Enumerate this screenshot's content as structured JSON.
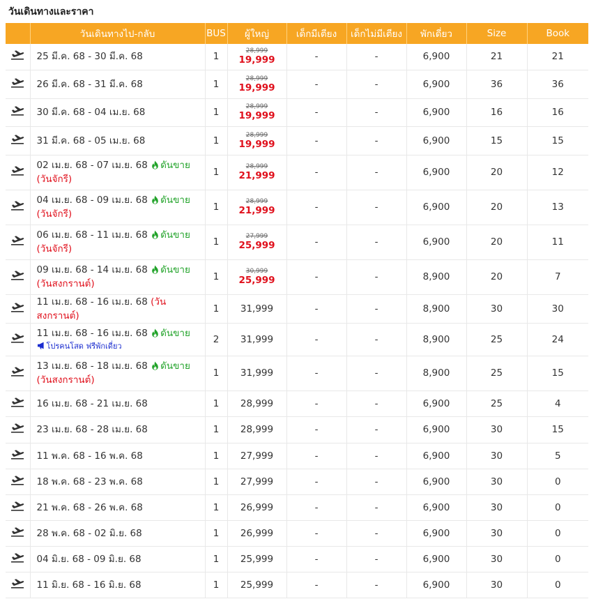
{
  "section_title": "วันเดินทางและราคา",
  "headers": [
    "",
    "วันเดินทางไป-กลับ",
    "BUS",
    "ผู้ใหญ่",
    "เด็กมีเตียง",
    "เด็กไม่มีเตียง",
    "พักเดี่ยว",
    "Size",
    "Book"
  ],
  "colors": {
    "header_bg": "#f7a623",
    "sale_price": "#e0101c",
    "hot_tag": "#22a32a",
    "promo": "#1a2ccf"
  },
  "rows": [
    {
      "dates": "25 มี.ค. 68 - 30 มี.ค. 68",
      "hot": "",
      "holiday": "",
      "promo": "",
      "bus": "1",
      "price_old": "28,999",
      "price": "19,999",
      "child_bed": "-",
      "child_nobed": "-",
      "single": "6,900",
      "size": "21",
      "book": "21"
    },
    {
      "dates": "26 มี.ค. 68 - 31 มี.ค. 68",
      "hot": "",
      "holiday": "",
      "promo": "",
      "bus": "1",
      "price_old": "28,999",
      "price": "19,999",
      "child_bed": "-",
      "child_nobed": "-",
      "single": "6,900",
      "size": "36",
      "book": "36"
    },
    {
      "dates": "30 มี.ค. 68 - 04 เม.ย. 68",
      "hot": "",
      "holiday": "",
      "promo": "",
      "bus": "1",
      "price_old": "28,999",
      "price": "19,999",
      "child_bed": "-",
      "child_nobed": "-",
      "single": "6,900",
      "size": "16",
      "book": "16"
    },
    {
      "dates": "31 มี.ค. 68 - 05 เม.ย. 68",
      "hot": "",
      "holiday": "",
      "promo": "",
      "bus": "1",
      "price_old": "28,999",
      "price": "19,999",
      "child_bed": "-",
      "child_nobed": "-",
      "single": "6,900",
      "size": "15",
      "book": "15"
    },
    {
      "dates": "02 เม.ย. 68 - 07 เม.ย. 68",
      "hot": "ดันขาย",
      "holiday": "(วันจักรี)",
      "promo": "",
      "bus": "1",
      "price_old": "28,999",
      "price": "21,999",
      "child_bed": "-",
      "child_nobed": "-",
      "single": "6,900",
      "size": "20",
      "book": "12"
    },
    {
      "dates": "04 เม.ย. 68 - 09 เม.ย. 68",
      "hot": "ดันขาย",
      "holiday": "(วันจักรี)",
      "promo": "",
      "bus": "1",
      "price_old": "28,999",
      "price": "21,999",
      "child_bed": "-",
      "child_nobed": "-",
      "single": "6,900",
      "size": "20",
      "book": "13"
    },
    {
      "dates": "06 เม.ย. 68 - 11 เม.ย. 68",
      "hot": "ดันขาย",
      "holiday": "(วันจักรี)",
      "promo": "",
      "bus": "1",
      "price_old": "27,999",
      "price": "25,999",
      "child_bed": "-",
      "child_nobed": "-",
      "single": "6,900",
      "size": "20",
      "book": "11"
    },
    {
      "dates": "09 เม.ย. 68 - 14 เม.ย. 68",
      "hot": "ดันขาย",
      "holiday": "(วันสงกรานต์)",
      "promo": "",
      "bus": "1",
      "price_old": "30,999",
      "price": "25,999",
      "child_bed": "-",
      "child_nobed": "-",
      "single": "8,900",
      "size": "20",
      "book": "7"
    },
    {
      "dates": "11 เม.ย. 68 - 16 เม.ย. 68",
      "hot": "",
      "holiday": "(วันสงกรานต์)",
      "promo": "",
      "bus": "1",
      "price_old": "",
      "price": "31,999",
      "child_bed": "-",
      "child_nobed": "-",
      "single": "8,900",
      "size": "30",
      "book": "30"
    },
    {
      "dates": "11 เม.ย. 68 - 16 เม.ย. 68",
      "hot": "ดันขาย",
      "holiday": "",
      "promo": "โปรคนโสด ฟรีพักเดี่ยว",
      "bus": "2",
      "price_old": "",
      "price": "31,999",
      "child_bed": "-",
      "child_nobed": "-",
      "single": "8,900",
      "size": "25",
      "book": "24"
    },
    {
      "dates": "13 เม.ย. 68 - 18 เม.ย. 68",
      "hot": "ดันขาย",
      "holiday": "(วันสงกรานต์)",
      "promo": "",
      "bus": "1",
      "price_old": "",
      "price": "31,999",
      "child_bed": "-",
      "child_nobed": "-",
      "single": "8,900",
      "size": "25",
      "book": "15"
    },
    {
      "dates": "16 เม.ย. 68 - 21 เม.ย. 68",
      "hot": "",
      "holiday": "",
      "promo": "",
      "bus": "1",
      "price_old": "",
      "price": "28,999",
      "child_bed": "-",
      "child_nobed": "-",
      "single": "6,900",
      "size": "25",
      "book": "4"
    },
    {
      "dates": "23 เม.ย. 68 - 28 เม.ย. 68",
      "hot": "",
      "holiday": "",
      "promo": "",
      "bus": "1",
      "price_old": "",
      "price": "28,999",
      "child_bed": "-",
      "child_nobed": "-",
      "single": "6,900",
      "size": "30",
      "book": "15"
    },
    {
      "dates": "11 พ.ค. 68 - 16 พ.ค. 68",
      "hot": "",
      "holiday": "",
      "promo": "",
      "bus": "1",
      "price_old": "",
      "price": "27,999",
      "child_bed": "-",
      "child_nobed": "-",
      "single": "6,900",
      "size": "30",
      "book": "5"
    },
    {
      "dates": "18 พ.ค. 68 - 23 พ.ค. 68",
      "hot": "",
      "holiday": "",
      "promo": "",
      "bus": "1",
      "price_old": "",
      "price": "27,999",
      "child_bed": "-",
      "child_nobed": "-",
      "single": "6,900",
      "size": "30",
      "book": "0"
    },
    {
      "dates": "21 พ.ค. 68 - 26 พ.ค. 68",
      "hot": "",
      "holiday": "",
      "promo": "",
      "bus": "1",
      "price_old": "",
      "price": "26,999",
      "child_bed": "-",
      "child_nobed": "-",
      "single": "6,900",
      "size": "30",
      "book": "0"
    },
    {
      "dates": "28 พ.ค. 68 - 02 มิ.ย. 68",
      "hot": "",
      "holiday": "",
      "promo": "",
      "bus": "1",
      "price_old": "",
      "price": "26,999",
      "child_bed": "-",
      "child_nobed": "-",
      "single": "6,900",
      "size": "30",
      "book": "0"
    },
    {
      "dates": "04 มิ.ย. 68 - 09 มิ.ย. 68",
      "hot": "",
      "holiday": "",
      "promo": "",
      "bus": "1",
      "price_old": "",
      "price": "25,999",
      "child_bed": "-",
      "child_nobed": "-",
      "single": "6,900",
      "size": "30",
      "book": "0"
    },
    {
      "dates": "11 มิ.ย. 68 - 16 มิ.ย. 68",
      "hot": "",
      "holiday": "",
      "promo": "",
      "bus": "1",
      "price_old": "",
      "price": "25,999",
      "child_bed": "-",
      "child_nobed": "-",
      "single": "6,900",
      "size": "30",
      "book": "0"
    }
  ]
}
